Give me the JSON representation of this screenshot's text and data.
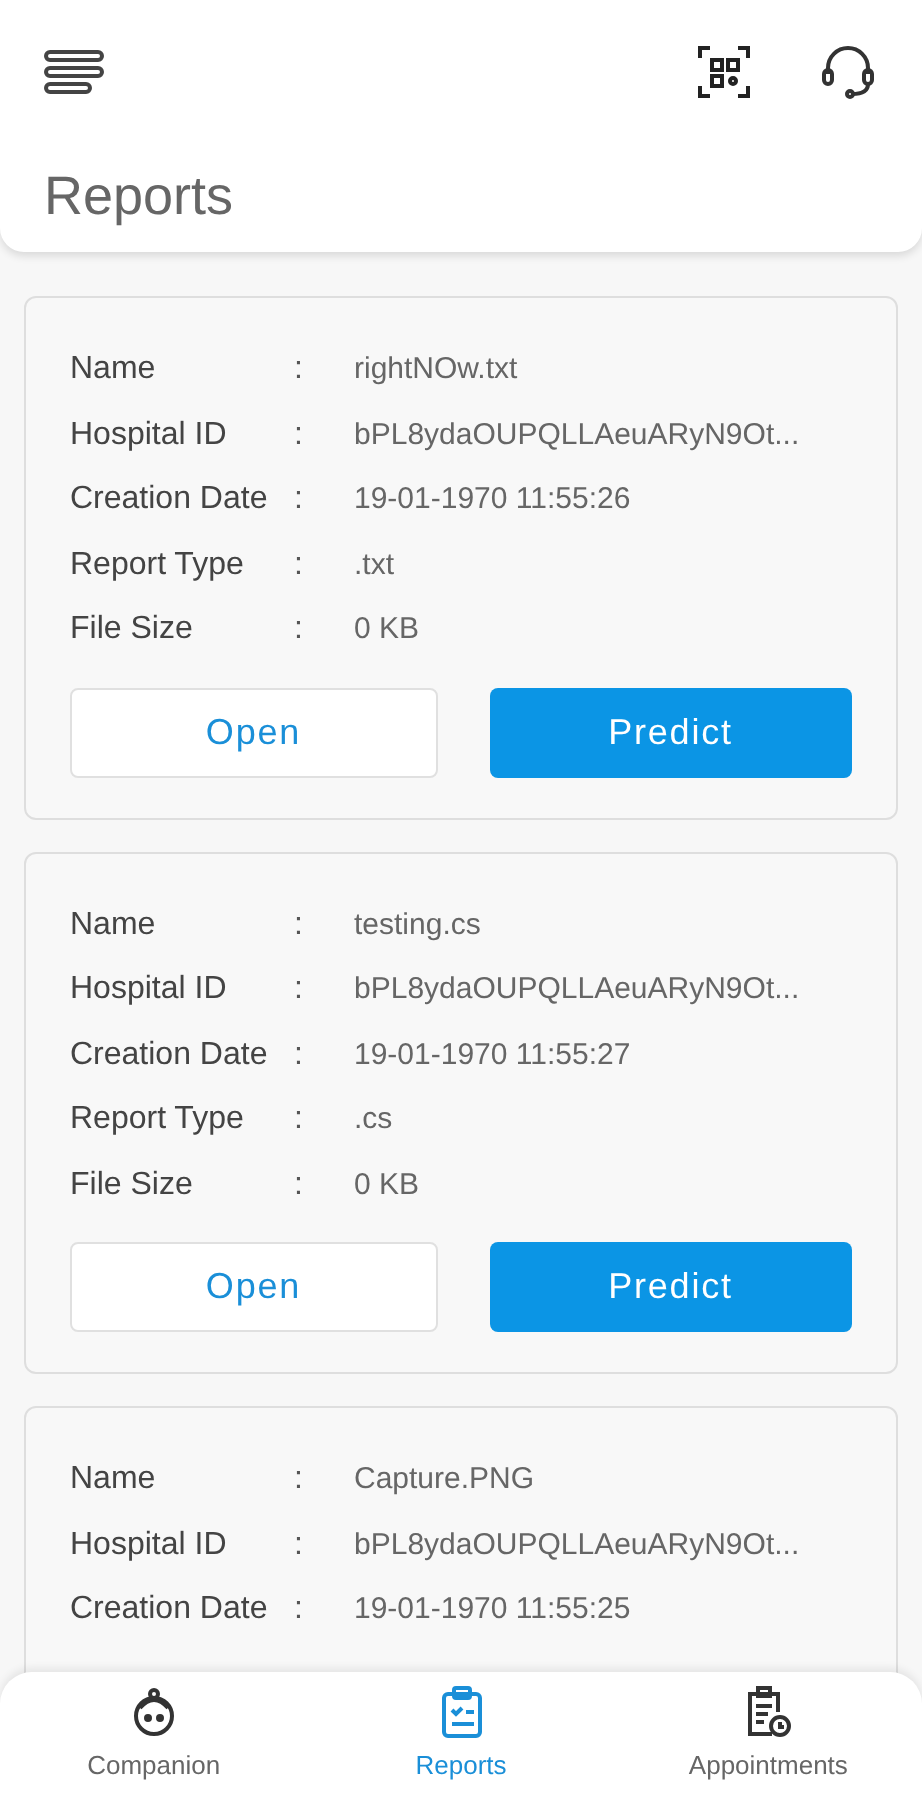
{
  "header": {
    "title": "Reports"
  },
  "reports": [
    {
      "fields": [
        {
          "label": "Name",
          "value": "rightNOw.txt"
        },
        {
          "label": "Hospital ID",
          "value": "bPL8ydaOUPQLLAeuARyN9Ot..."
        },
        {
          "label": "Creation Date",
          "value": "19-01-1970 11:55:26"
        },
        {
          "label": "Report Type",
          "value": ".txt"
        },
        {
          "label": "File Size",
          "value": "0 KB"
        }
      ],
      "buttons": [
        {
          "label": "Open",
          "kind": "outline"
        },
        {
          "label": "Predict",
          "kind": "filled"
        }
      ]
    },
    {
      "fields": [
        {
          "label": "Name",
          "value": "testing.cs"
        },
        {
          "label": "Hospital ID",
          "value": "bPL8ydaOUPQLLAeuARyN9Ot..."
        },
        {
          "label": "Creation Date",
          "value": "19-01-1970 11:55:27"
        },
        {
          "label": "Report Type",
          "value": ".cs"
        },
        {
          "label": "File Size",
          "value": "0 KB"
        }
      ],
      "buttons": [
        {
          "label": "Open",
          "kind": "outline"
        },
        {
          "label": "Predict",
          "kind": "filled"
        }
      ]
    },
    {
      "fields": [
        {
          "label": "Name",
          "value": "Capture.PNG"
        },
        {
          "label": "Hospital ID",
          "value": "bPL8ydaOUPQLLAeuARyN9Ot..."
        },
        {
          "label": "Creation Date",
          "value": "19-01-1970 11:55:25"
        }
      ]
    }
  ],
  "separator": ":",
  "bottom_nav": [
    {
      "label": "Companion",
      "kind": "companion",
      "selected": false
    },
    {
      "label": "Reports",
      "kind": "reports",
      "selected": true
    },
    {
      "label": "Appointments",
      "kind": "appointments",
      "selected": false
    }
  ]
}
